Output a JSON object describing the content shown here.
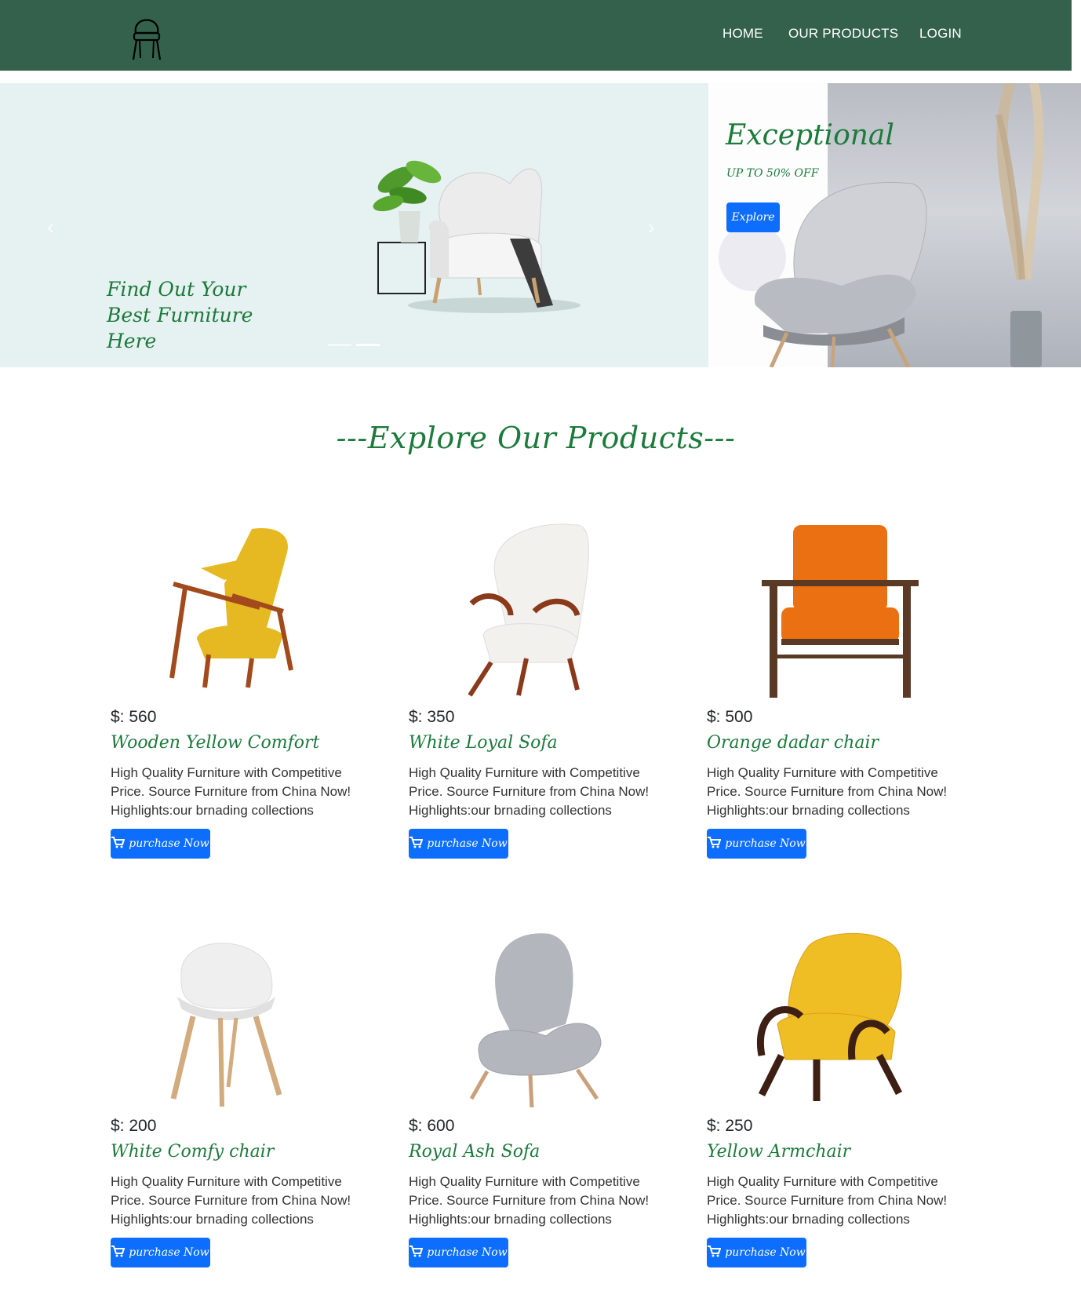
{
  "nav": {
    "logo_icon": "chair-icon",
    "links": [
      "HOME",
      "OUR PRODUCTS",
      "LOGIN"
    ]
  },
  "hero": {
    "headline": "Find Out Your Best Furniture Here",
    "prev_icon": "chevron-left-icon",
    "next_icon": "chevron-right-icon",
    "slides": 2
  },
  "promo": {
    "title": "Exceptional",
    "subtitle": "UP TO 50% OFF",
    "button": "Explore"
  },
  "section": {
    "title": "---Explore Our Products---"
  },
  "products": [
    {
      "price": "$: 560",
      "name": "Wooden Yellow Comfort",
      "desc": "High Quality Furniture with Competitive Price. Source Furniture from China Now! Highlights:our brnading collections",
      "button": "purchase Now",
      "seat": "#e6b822",
      "frame": "#a34a1d"
    },
    {
      "price": "$: 350",
      "name": "White Loyal Sofa",
      "desc": "High Quality Furniture with Competitive Price. Source Furniture from China Now! Highlights:our brnading collections",
      "button": "purchase Now",
      "seat": "#f3f1ee",
      "frame": "#8a3a1a"
    },
    {
      "price": "$: 500",
      "name": "Orange dadar chair",
      "desc": "High Quality Furniture with Competitive Price. Source Furniture from China Now! Highlights:our brnading collections",
      "button": "purchase Now",
      "seat": "#ea7012",
      "frame": "#5b3a25"
    },
    {
      "price": "$: 200",
      "name": "White Comfy chair",
      "desc": "High Quality Furniture with Competitive Price. Source Furniture from China Now! Highlights:our brnading collections",
      "button": "purchase Now",
      "seat": "#efefef",
      "frame": "#d2ab7e"
    },
    {
      "price": "$: 600",
      "name": "Royal Ash Sofa",
      "desc": "High Quality Furniture with Competitive Price. Source Furniture from China Now! Highlights:our brnading collections",
      "button": "purchase Now",
      "seat": "#b3b6bc",
      "frame": "#caa07a"
    },
    {
      "price": "$: 250",
      "name": "Yellow Armchair",
      "desc": "High Quality Furniture with Competitive Price. Source Furniture from China Now! Highlights:our brnading collections",
      "button": "purchase Now",
      "seat": "#efbd24",
      "frame": "#3d1f14"
    }
  ],
  "colors": {
    "nav_bg": "#33614b",
    "accent_green": "#1c7a3b",
    "button_blue": "#0d6efd",
    "hero_bg": "#e6f1f1"
  }
}
